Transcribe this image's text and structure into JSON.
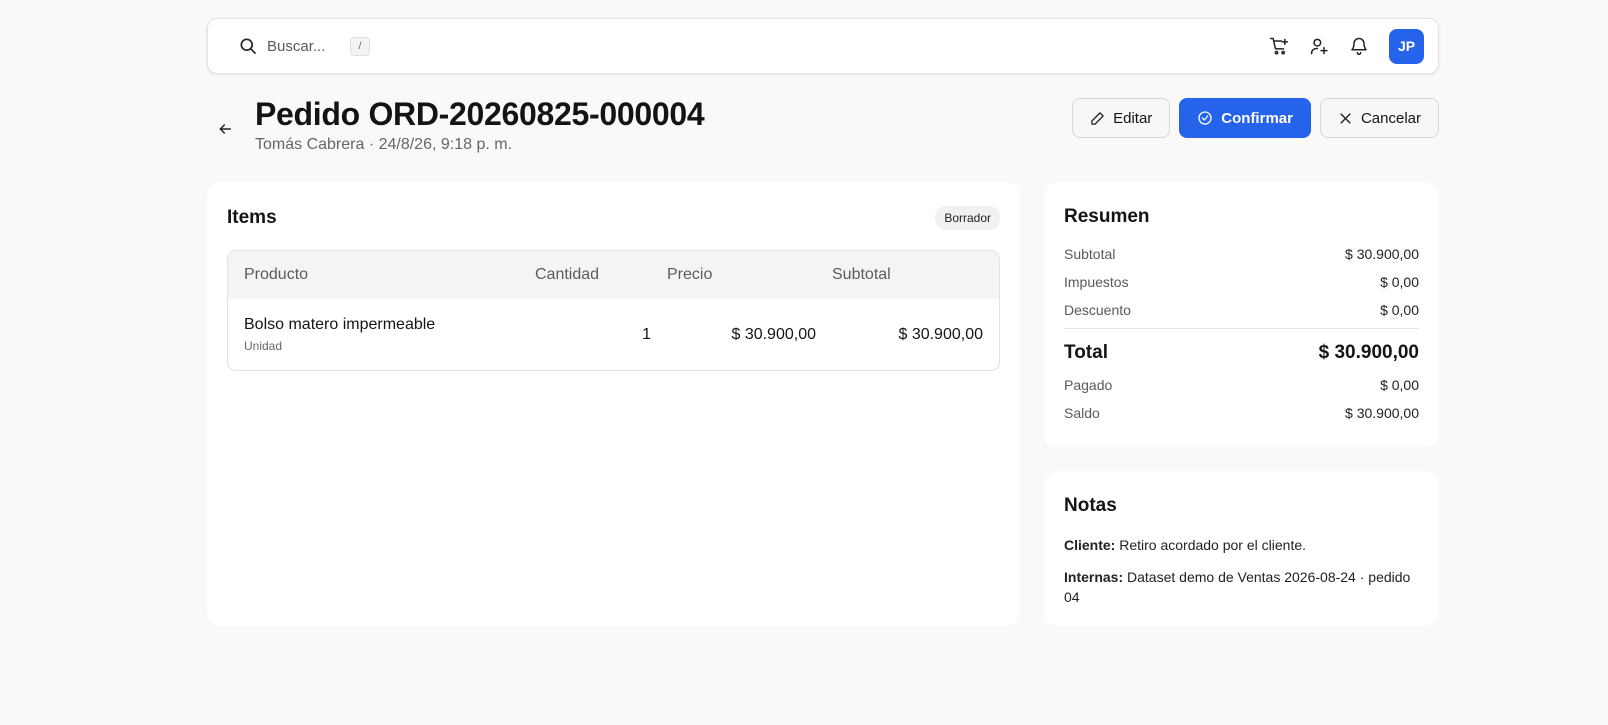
{
  "search": {
    "placeholder": "Buscar...",
    "shortcut": "/"
  },
  "topbar": {
    "icons": [
      "cart-plus-icon",
      "user-plus-icon",
      "bell-icon"
    ],
    "avatar_initials": "JP"
  },
  "header": {
    "title": "Pedido ORD-20260825-000004",
    "subtitle": "Tomás Cabrera · 24/8/26, 9:18 p. m."
  },
  "actions": {
    "edit_label": "Editar",
    "confirm_label": "Confirmar",
    "cancel_label": "Cancelar"
  },
  "items": {
    "title": "Items",
    "status": "Borrador",
    "columns": [
      "Producto",
      "Cantidad",
      "Precio",
      "Subtotal"
    ],
    "rows": [
      {
        "product": "Bolso matero impermeable",
        "unit": "Unidad",
        "quantity": "1",
        "price": "$ 30.900,00",
        "subtotal": "$ 30.900,00"
      }
    ]
  },
  "summary": {
    "title": "Resumen",
    "subtotal_label": "Subtotal",
    "subtotal": "$ 30.900,00",
    "taxes_label": "Impuestos",
    "taxes": "$ 0,00",
    "discount_label": "Descuento",
    "discount": "$ 0,00",
    "total_label": "Total",
    "total": "$ 30.900,00",
    "paid_label": "Pagado",
    "paid": "$ 0,00",
    "balance_label": "Saldo",
    "balance": "$ 30.900,00"
  },
  "notes": {
    "title": "Notas",
    "client_label": "Cliente:",
    "client_text": " Retiro acordado por el cliente.",
    "internal_label": "Internas:",
    "internal_text": " Dataset demo de Ventas 2026-08-24 · pedido 04"
  },
  "colors": {
    "accent": "#2563eb",
    "background": "#f9f9f9"
  }
}
